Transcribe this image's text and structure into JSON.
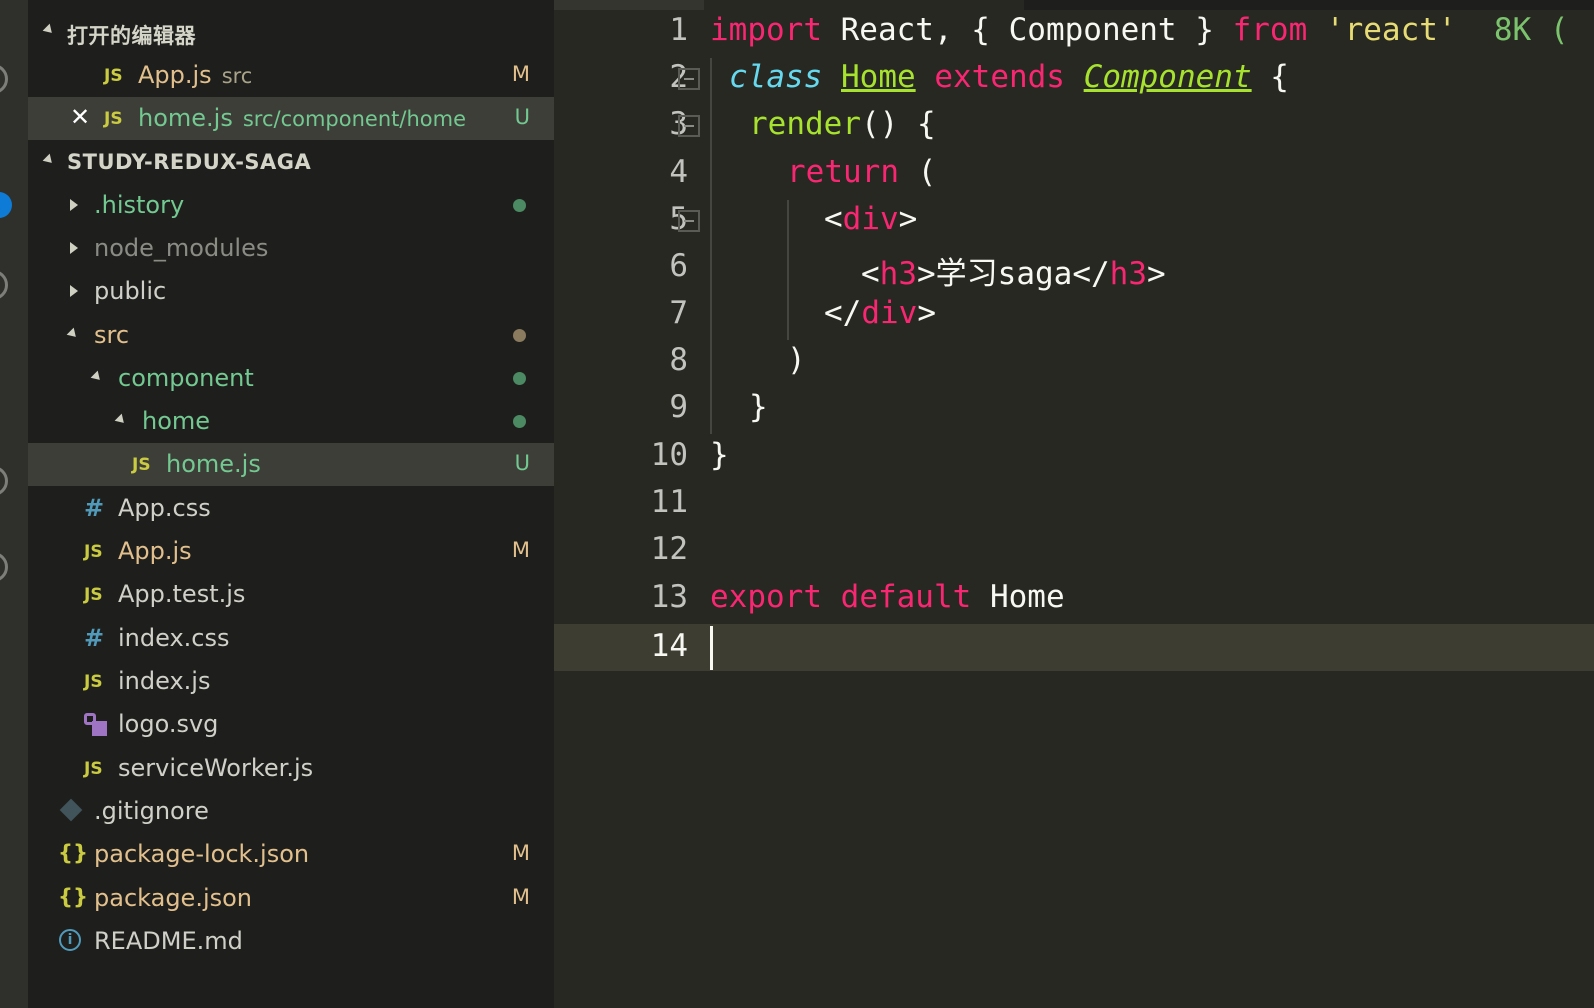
{
  "sidebar": {
    "open_editors": {
      "title": "打开的编辑器",
      "items": [
        {
          "icon": "JS",
          "name": "App.js",
          "desc": "src",
          "badge": "M"
        },
        {
          "icon": "JS",
          "close": "✕",
          "name": "home.js",
          "desc": "src/component/home",
          "badge": "U"
        }
      ]
    },
    "project": {
      "title": "STUDY-REDUX-SAGA",
      "items": [
        {
          "name": ".history",
          "kind": "folder-collapsed"
        },
        {
          "name": "node_modules",
          "kind": "folder-collapsed"
        },
        {
          "name": "public",
          "kind": "folder-collapsed"
        },
        {
          "name": "src",
          "kind": "folder-expanded"
        },
        {
          "name": "component",
          "kind": "folder-expanded"
        },
        {
          "name": "home",
          "kind": "folder-expanded"
        },
        {
          "icon": "JS",
          "name": "home.js",
          "badge": "U"
        },
        {
          "icon": "#",
          "name": "App.css"
        },
        {
          "icon": "JS",
          "name": "App.js",
          "badge": "M"
        },
        {
          "icon": "JS",
          "name": "App.test.js"
        },
        {
          "icon": "#",
          "name": "index.css"
        },
        {
          "icon": "JS",
          "name": "index.js"
        },
        {
          "icon": "svg-icon",
          "name": "logo.svg"
        },
        {
          "icon": "JS",
          "name": "serviceWorker.js"
        },
        {
          "icon": "git-icon",
          "name": ".gitignore"
        },
        {
          "icon": "{}",
          "name": "package-lock.json",
          "badge": "M"
        },
        {
          "icon": "{}",
          "name": "package.json",
          "badge": "M"
        },
        {
          "icon": "i",
          "name": "README.md"
        }
      ]
    }
  },
  "editor": {
    "line_numbers": [
      "1",
      "2",
      "3",
      "4",
      "5",
      "6",
      "7",
      "8",
      "9",
      "10",
      "11",
      "12",
      "13",
      "14"
    ],
    "code": {
      "l1": {
        "import": "import",
        "react": " React, { Component } ",
        "from": "from",
        "str": " 'react'",
        "hint": "  8K ("
      },
      "l2": {
        "class": "class",
        "home": "Home",
        "extends": "extends",
        "component": "Component",
        "brace": " {"
      },
      "l3": {
        "render": "render",
        "rest": "() {"
      },
      "l4": {
        "return": "return",
        "rest": " ("
      },
      "l5": {
        "open": "<",
        "div": "div",
        "close": ">"
      },
      "l6": {
        "open": "<",
        "h3a": "h3",
        "mid": ">学习saga</",
        "h3b": "h3",
        "close": ">"
      },
      "l7": {
        "open": "</",
        "div": "div",
        "close": ">"
      },
      "l8": ")",
      "l9": "}",
      "l10": "}",
      "l13": {
        "export": "export",
        "default": "default",
        "home": " Home"
      }
    }
  },
  "colors": {
    "editor_bg": "#272822",
    "sidebar_bg": "#1e1f1c",
    "selection": "#3d3e38",
    "keyword": "#f92672",
    "function": "#a6e22e",
    "storage_type": "#66d9ef",
    "string": "#e6db74",
    "git_modified": "#e2c08d",
    "git_untracked": "#73c991"
  }
}
